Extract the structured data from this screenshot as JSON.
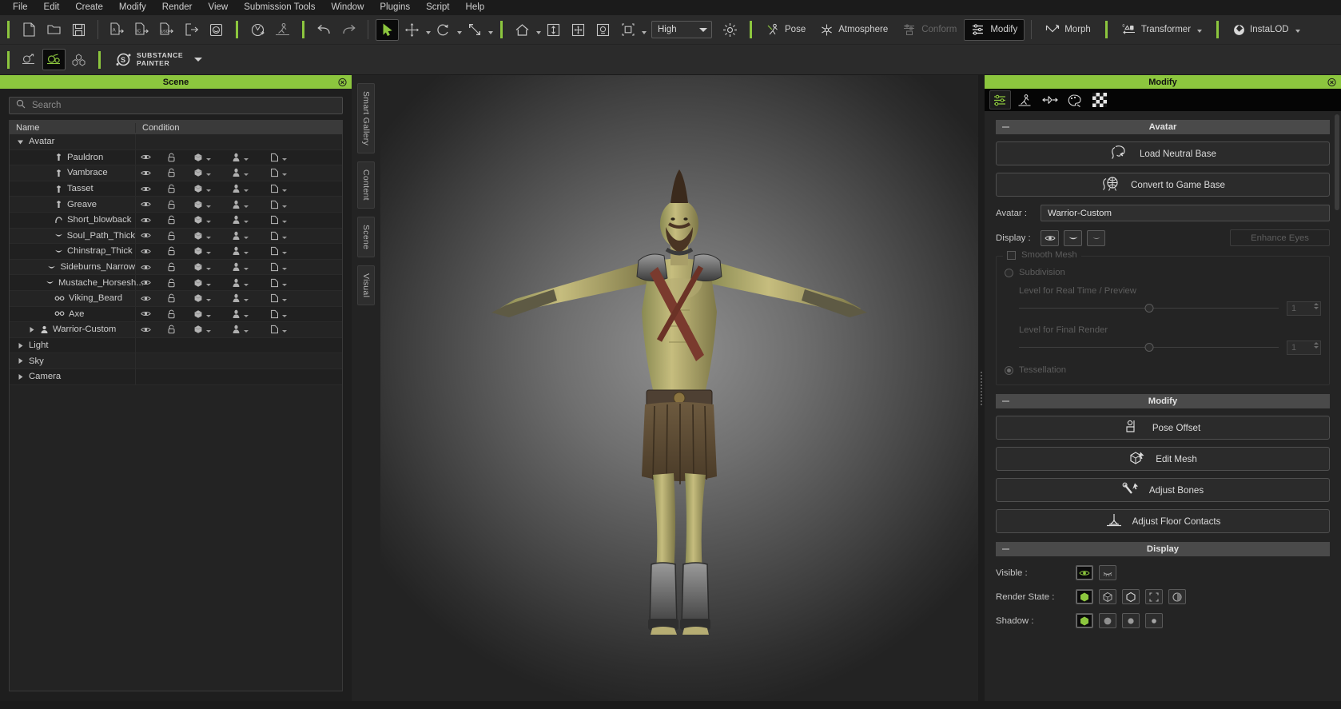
{
  "app": {
    "menu": [
      "File",
      "Edit",
      "Create",
      "Modify",
      "Render",
      "View",
      "Submission Tools",
      "Window",
      "Plugins",
      "Script",
      "Help"
    ]
  },
  "toolbar": {
    "quality_value": "High",
    "pose_label": "Pose",
    "atmosphere_label": "Atmosphere",
    "conform_label": "Conform",
    "modify_label": "Modify",
    "morph_label": "Morph",
    "transformer_label": "Transformer",
    "instalod_label": "InstaLOD",
    "substance_line1": "SUBSTANCE",
    "substance_line2": "PAINTER"
  },
  "scene_panel": {
    "title": "Scene",
    "search_placeholder": "Search",
    "columns": {
      "name": "Name",
      "condition": "Condition"
    },
    "rows": [
      {
        "label": "Avatar",
        "indent": 0,
        "icon": "expanded-triangle",
        "group": true,
        "cond": false
      },
      {
        "label": "Pauldron",
        "indent": 2,
        "icon": "cloth-icon",
        "group": false,
        "cond": true
      },
      {
        "label": "Vambrace",
        "indent": 2,
        "icon": "cloth-icon",
        "group": false,
        "cond": true
      },
      {
        "label": "Tasset",
        "indent": 2,
        "icon": "cloth-icon",
        "group": false,
        "cond": true
      },
      {
        "label": "Greave",
        "indent": 2,
        "icon": "cloth-icon",
        "group": false,
        "cond": true
      },
      {
        "label": "Short_blowback",
        "indent": 2,
        "icon": "hair-icon",
        "group": false,
        "cond": true
      },
      {
        "label": "Soul_Path_Thick",
        "indent": 2,
        "icon": "brow-icon",
        "group": false,
        "cond": true
      },
      {
        "label": "Chinstrap_Thick",
        "indent": 2,
        "icon": "brow-icon",
        "group": false,
        "cond": true
      },
      {
        "label": "Sideburns_Narrow",
        "indent": 2,
        "icon": "brow-icon",
        "group": false,
        "cond": true
      },
      {
        "label": "Mustache_Horsesh...",
        "indent": 2,
        "icon": "brow-icon",
        "group": false,
        "cond": true
      },
      {
        "label": "Viking_Beard",
        "indent": 2,
        "icon": "beard-icon",
        "group": false,
        "cond": true
      },
      {
        "label": "Axe",
        "indent": 2,
        "icon": "beard-icon",
        "group": false,
        "cond": true
      },
      {
        "label": "Warrior-Custom",
        "indent": 1,
        "icon": "avatar-icon",
        "group": false,
        "cond": true,
        "collapsed": true
      },
      {
        "label": "Light",
        "indent": 0,
        "icon": "collapsed-triangle",
        "group": true,
        "cond": false
      },
      {
        "label": "Sky",
        "indent": 0,
        "icon": "collapsed-triangle",
        "group": true,
        "cond": false
      },
      {
        "label": "Camera",
        "indent": 0,
        "icon": "collapsed-triangle",
        "group": true,
        "cond": false
      }
    ]
  },
  "side_tabs": [
    "Smart Gallery",
    "Content",
    "Scene",
    "Visual"
  ],
  "modify_panel": {
    "title": "Modify",
    "tabs": [
      "sliders-tab",
      "pose-tab",
      "morph-tab",
      "material-tab",
      "checker-tab"
    ],
    "avatar_section": {
      "header": "Avatar",
      "load_neutral_base": "Load Neutral Base",
      "convert_to_game_base": "Convert to Game Base",
      "avatar_label": "Avatar :",
      "avatar_value": "Warrior-Custom",
      "display_label": "Display :",
      "enhance_eyes": "Enhance Eyes",
      "smooth_mesh": "Smooth Mesh",
      "subdivision": "Subdivision",
      "level_realtime": "Level for Real Time / Preview",
      "level_realtime_value": "1",
      "level_final": "Level for Final Render",
      "level_final_value": "1",
      "tessellation": "Tessellation"
    },
    "modify_section": {
      "header": "Modify",
      "buttons": [
        "Pose Offset",
        "Edit Mesh",
        "Adjust Bones",
        "Adjust Floor Contacts"
      ]
    },
    "display_section": {
      "header": "Display",
      "visible_label": "Visible :",
      "render_state_label": "Render State :",
      "shadow_label": "Shadow :"
    }
  },
  "colors": {
    "accent_green": "#8cc63e",
    "panel_bg": "#242424",
    "toolbar_bg": "#2b2b2b"
  }
}
